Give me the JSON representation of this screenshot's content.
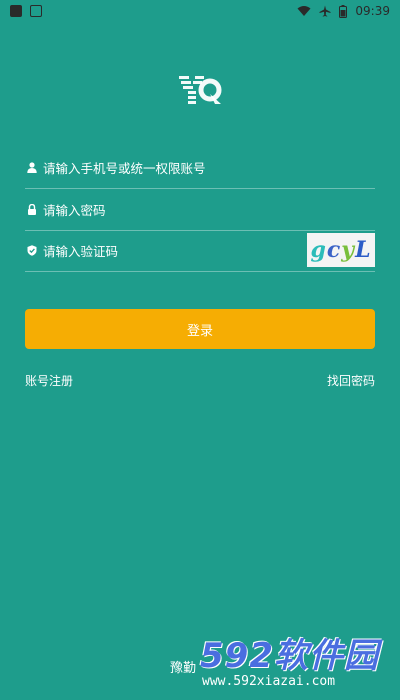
{
  "status_bar": {
    "time": "09:39",
    "icons": [
      "app-icon",
      "image-icon",
      "wifi-icon",
      "airplane-icon",
      "battery-icon"
    ]
  },
  "logo": {
    "text": "YO"
  },
  "form": {
    "account_placeholder": "请输入手机号或统一权限账号",
    "password_placeholder": "请输入密码",
    "captcha_placeholder": "请输入验证码",
    "captcha_text": [
      "g",
      "c",
      "y",
      "L"
    ]
  },
  "actions": {
    "login_label": "登录",
    "register_label": "账号注册",
    "forgot_label": "找回密码"
  },
  "footer": {
    "text": "豫勤"
  },
  "watermark": {
    "main": "592软件园",
    "url": "www.592xiazai.com"
  },
  "colors": {
    "background": "#1e9d8c",
    "accent": "#f6ad03"
  }
}
